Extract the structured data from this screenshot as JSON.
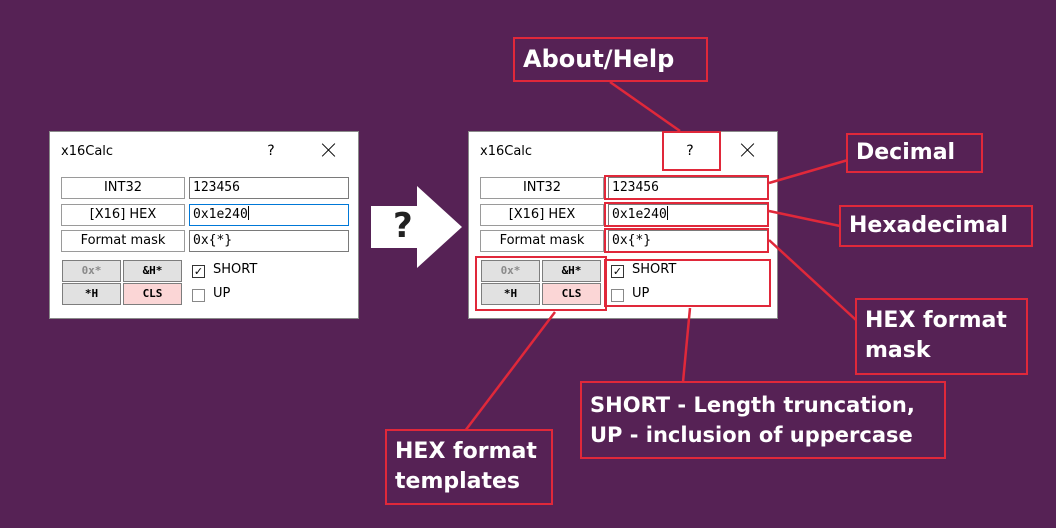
{
  "window": {
    "title": "x16Calc",
    "help": "?",
    "labels": {
      "int32": "INT32",
      "hex": "[X16] HEX",
      "mask": "Format mask"
    },
    "values": {
      "decimal": "123456",
      "hex": "0x1e240",
      "mask": "0x{*}"
    },
    "templates": {
      "t1": "0x*",
      "t2": "&H*",
      "t3": "*H",
      "cls": "CLS"
    },
    "checkboxes": {
      "short": {
        "label": "SHORT",
        "checked": true
      },
      "up": {
        "label": "UP",
        "checked": false
      }
    },
    "check_mark": "✓"
  },
  "arrow": {
    "symbol": "?"
  },
  "callouts": {
    "about": "About/Help",
    "decimal": "Decimal",
    "hexadecimal": "Hexadecimal",
    "hex_mask_line1": "HEX format",
    "hex_mask_line2": "mask",
    "options_line1": "SHORT - Length truncation,",
    "options_line2": "UP - inclusion of uppercase",
    "templates_line1": "HEX format",
    "templates_line2": "templates"
  },
  "colors": {
    "background": "#562255",
    "accent": "#e0283a",
    "cls_button": "#fbd6d6",
    "focus_border": "#0078d7"
  }
}
